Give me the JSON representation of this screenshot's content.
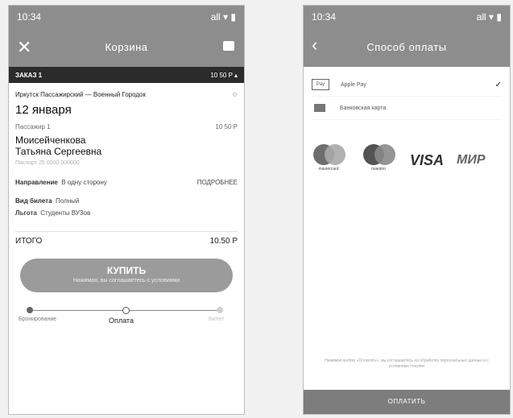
{
  "left": {
    "status": {
      "time": "10:34",
      "signal": "all ▾ ▮"
    },
    "nav": {
      "title": "Корзина"
    },
    "order": {
      "label": "ЗАКАЗ 1",
      "price": "10 50 P ▴"
    },
    "route": "Иркутск Пассажирский — Военный Городок",
    "date": "12 января",
    "passenger": {
      "tag": "Пассажир 1",
      "price": "10 50 P",
      "name_line1": "Моисейченкова",
      "name_line2": "Татьяна Сергеевна",
      "doc": "Паспорт 25 0000 000000"
    },
    "direction": {
      "label": "Направление",
      "value": "В одну сторону",
      "link": "ПОДРОБНЕЕ"
    },
    "ticket_type": {
      "label": "Вид билета",
      "value": "Полный"
    },
    "benefit": {
      "label": "Льгота",
      "value": "Студенты ВУЗов"
    },
    "total": {
      "label": "ИТОГО",
      "value": "10.50 P"
    },
    "buy": {
      "label": "КУПИТЬ",
      "sub": "Нажимая, вы соглашаетесь с условиями"
    },
    "steps": [
      "Бронирование",
      "Оплата",
      "Билет"
    ]
  },
  "right": {
    "status": {
      "time": "10:34",
      "signal": "all ▾ ▮"
    },
    "nav": {
      "title": "Способ оплаты"
    },
    "methods": [
      {
        "badge": "Pay",
        "label": "Apple Pay",
        "check": "✓"
      },
      {
        "label": "Банковская карта"
      }
    ],
    "logos": {
      "mastercard": "mastercard",
      "maestro": "maestro",
      "visa": "VISA",
      "mir": "МИР"
    },
    "disclaimer": "Нажимая кнопку «Оплатить», вы соглашаетесь на обработку персональных данных и с условиями покупки",
    "pay_button": "ОПЛАТИТЬ"
  },
  "colors": {
    "topbar": "#8c8c8c",
    "orderbar": "#2f2f2f",
    "button": "#9a9a9a"
  }
}
